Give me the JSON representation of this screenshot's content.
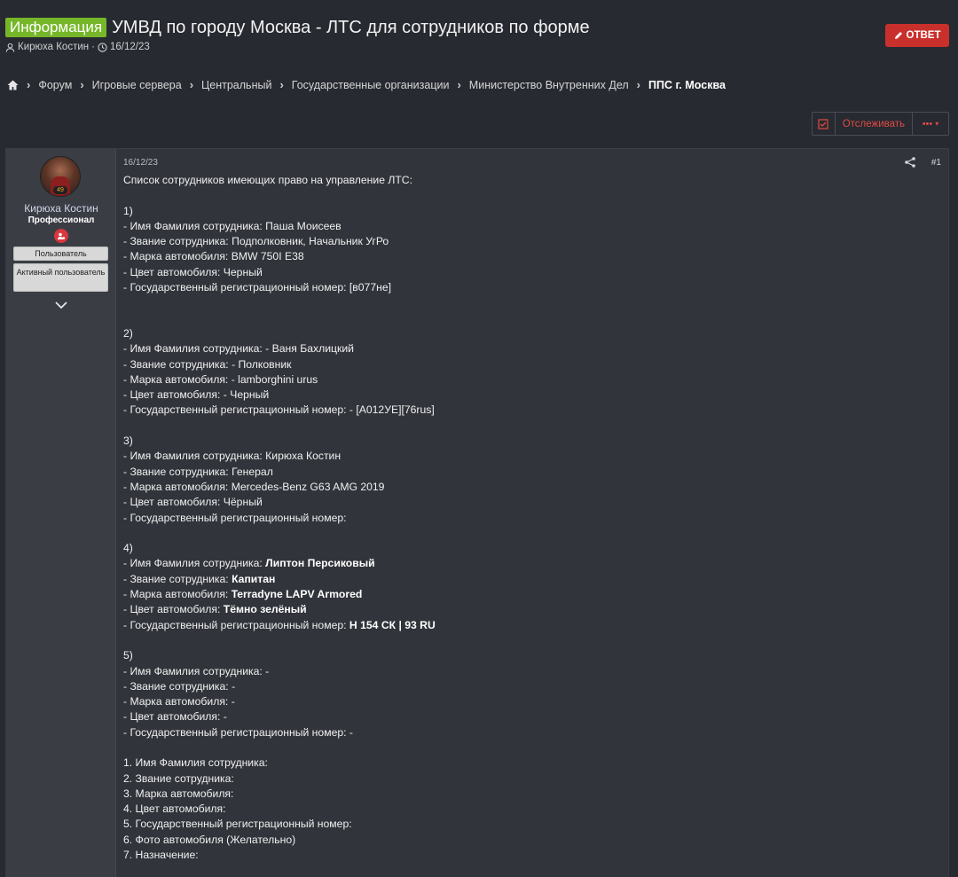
{
  "thread": {
    "prefix": "Информация",
    "title": "УМВД по городу Москва - ЛТС для сотрудников по форме",
    "author": "Кирюха Костин",
    "separator": "·",
    "date": "16/12/23",
    "reply_label": "ОТВЕТ"
  },
  "breadcrumb": {
    "items": [
      "Форум",
      "Игровые сервера",
      "Центральный",
      "Государственные организации",
      "Министерство Внутренних Дел"
    ],
    "current": "ППС г. Москва"
  },
  "actions": {
    "watch_label": "Отслеживать",
    "more_label": "•••"
  },
  "user": {
    "name": "Кирюха Костин",
    "title": "Профессионал",
    "avatar_badge": "49",
    "banner1": "Пользователь",
    "banner2": "Активный пользователь"
  },
  "post": {
    "date": "16/12/23",
    "number": "#1",
    "intro": "Список сотрудников имеющих право на управление ЛТС:",
    "entries": [
      {
        "num": "1)",
        "lines": [
          {
            "label": "- Имя Фамилия сотрудника: ",
            "value": "Паша Моисеев",
            "bold": false
          },
          {
            "label": "- Звание сотрудника: ",
            "value": "Подполковник, Начальник УгРо",
            "bold": false
          },
          {
            "label": "- Марка автомобиля: ",
            "value": "BMW 750I E38",
            "bold": false
          },
          {
            "label": "- Цвет автомобиля: ",
            "value": "Черный",
            "bold": false
          },
          {
            "label": "- Государственный регистрационный номер: ",
            "value": "[в077не]",
            "bold": false
          }
        ]
      },
      {
        "num": "2)",
        "lines": [
          {
            "label": "- Имя Фамилия сотрудника: ",
            "value": "- Ваня Бахлицкий",
            "bold": false
          },
          {
            "label": "- Звание сотрудника: ",
            "value": "- Полковник",
            "bold": false
          },
          {
            "label": "- Марка автомобиля: ",
            "value": "- lamborghini urus",
            "bold": false
          },
          {
            "label": "- Цвет автомобиля: ",
            "value": "- Черный",
            "bold": false
          },
          {
            "label": "- Государственный регистрационный номер: ",
            "value": "- [А012УЕ][76rus]",
            "bold": false
          }
        ]
      },
      {
        "num": "3)",
        "lines": [
          {
            "label": "- Имя Фамилия сотрудника: ",
            "value": "Кирюха Костин",
            "bold": false
          },
          {
            "label": "- Звание сотрудника: ",
            "value": "Генерал",
            "bold": false
          },
          {
            "label": "- Марка автомобиля: ",
            "value": "Mercedes-Benz G63 AMG 2019",
            "bold": false
          },
          {
            "label": "- Цвет автомобиля: ",
            "value": "Чёрный",
            "bold": false
          },
          {
            "label": "- Государственный регистрационный номер:",
            "value": "",
            "bold": false
          }
        ]
      },
      {
        "num": "4)",
        "lines": [
          {
            "label": "- Имя Фамилия сотрудника: ",
            "value": "Липтон Персиковый",
            "bold": true
          },
          {
            "label": "- Звание сотрудника: ",
            "value": "Капитан",
            "bold": true
          },
          {
            "label": "- Марка автомобиля: ",
            "value": "Terradyne LAPV Armored",
            "bold": true
          },
          {
            "label": "- Цвет автомобиля: ",
            "value": "Тёмно зелёный",
            "bold": true
          },
          {
            "label": "- Государственный регистрационный номер: ",
            "value": "Н 154 СК | 93 RU",
            "bold": true
          }
        ]
      },
      {
        "num": "5)",
        "lines": [
          {
            "label": "- Имя Фамилия сотрудника: ",
            "value": "-",
            "bold": false
          },
          {
            "label": "- Звание сотрудника: ",
            "value": "-",
            "bold": false
          },
          {
            "label": "- Марка автомобиля: ",
            "value": "-",
            "bold": false
          },
          {
            "label": "- Цвет автомобиля: ",
            "value": "-",
            "bold": false
          },
          {
            "label": "- Государственный регистрационный номер: ",
            "value": "-",
            "bold": false
          }
        ]
      }
    ],
    "template": [
      "1. Имя Фамилия сотрудника:",
      "2. Звание сотрудника:",
      "3. Марка автомобиля:",
      "4. Цвет автомобиля:",
      "5. Государственный регистрационный номер:",
      "6. Фото автомобиля (Желательно)",
      "7. Назначение:"
    ]
  },
  "colors": {
    "accent": "#c9302c",
    "prefix": "#75b728",
    "bg": "#272a31"
  }
}
